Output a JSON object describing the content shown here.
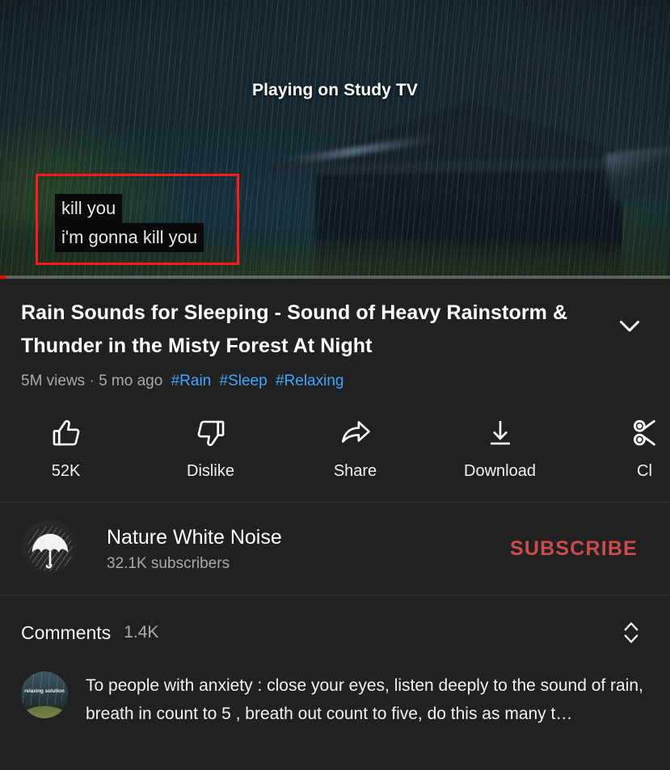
{
  "player": {
    "cast_status": "Playing on Study TV",
    "subtitles": [
      "kill you",
      "i'm gonna kill you"
    ],
    "progress_percent": 1,
    "progress_color": "#ff0000",
    "annotation_color": "#ff1a1a"
  },
  "video": {
    "title": "Rain Sounds for Sleeping - Sound of Heavy Rainstorm & Thunder in the Misty Forest At Night",
    "views": "5M views",
    "separator": "·",
    "age": "5 mo ago",
    "hashtags": [
      "#Rain",
      "#Sleep",
      "#Relaxing"
    ],
    "hashtag_color": "#3ea6ff",
    "expand_icon": "chevron-down-icon"
  },
  "actions": [
    {
      "icon": "thumbs-up-icon",
      "label": "52K"
    },
    {
      "icon": "thumbs-down-icon",
      "label": "Dislike"
    },
    {
      "icon": "share-arrow-icon",
      "label": "Share"
    },
    {
      "icon": "download-icon",
      "label": "Download"
    },
    {
      "icon": "clip-scissors-icon",
      "label": "Cl"
    }
  ],
  "channel": {
    "avatar_icon": "umbrella-rain-avatar",
    "name": "Nature White Noise",
    "subscribers": "32.1K subscribers",
    "subscribe_label": "SUBSCRIBE",
    "subscribe_color": "#cc4b4b"
  },
  "comments": {
    "title": "Comments",
    "count": "1.4K",
    "sort_icon": "chevron-up-down-icon",
    "top_comment": {
      "avatar_text": "relaxing solution",
      "text": "To people with anxiety : close your eyes, listen deeply to the sound of rain, breath in count to 5 , breath out count to five, do this as many t…"
    }
  }
}
